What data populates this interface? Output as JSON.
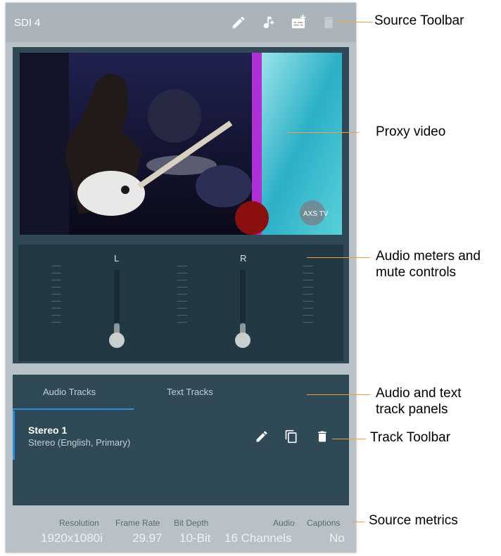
{
  "source": {
    "title": "SDI 4",
    "toolbar_icons": [
      "pencil-icon",
      "add-audio-icon",
      "add-subtitle-icon",
      "trash-icon"
    ]
  },
  "proxy_video": {
    "watermark": "AXS TV"
  },
  "audio_meters": {
    "left_label": "L",
    "right_label": "R",
    "left_level": 0,
    "right_level": 0
  },
  "track_panels": {
    "tabs": [
      "Audio Tracks",
      "Text Tracks"
    ],
    "active_tab": "Audio Tracks",
    "tracks": [
      {
        "name": "Stereo 1",
        "description": "Stereo (English, Primary)"
      }
    ],
    "row_icons": [
      "pencil-icon",
      "copy-icon",
      "trash-icon"
    ]
  },
  "metrics": {
    "resolution_label": "Resolution",
    "resolution": "1920x1080i",
    "frame_rate_label": "Frame Rate",
    "frame_rate": "29.97",
    "bit_depth_label": "Bit Depth",
    "bit_depth": "10-Bit",
    "audio_label": "Audio",
    "audio": "16 Channels",
    "captions_label": "Captions",
    "captions": "No"
  },
  "callouts": {
    "source_toolbar": "Source Toolbar",
    "proxy_video": "Proxy video",
    "audio_meters_1": "Audio meters and",
    "audio_meters_2": "mute controls",
    "track_panels_1": "Audio and text",
    "track_panels_2": "track panels",
    "track_toolbar": "Track Toolbar",
    "source_metrics": "Source metrics"
  },
  "colors": {
    "accent": "#2a8fd8",
    "leader": "#f4a040",
    "panel_dark": "#2f4a56"
  }
}
